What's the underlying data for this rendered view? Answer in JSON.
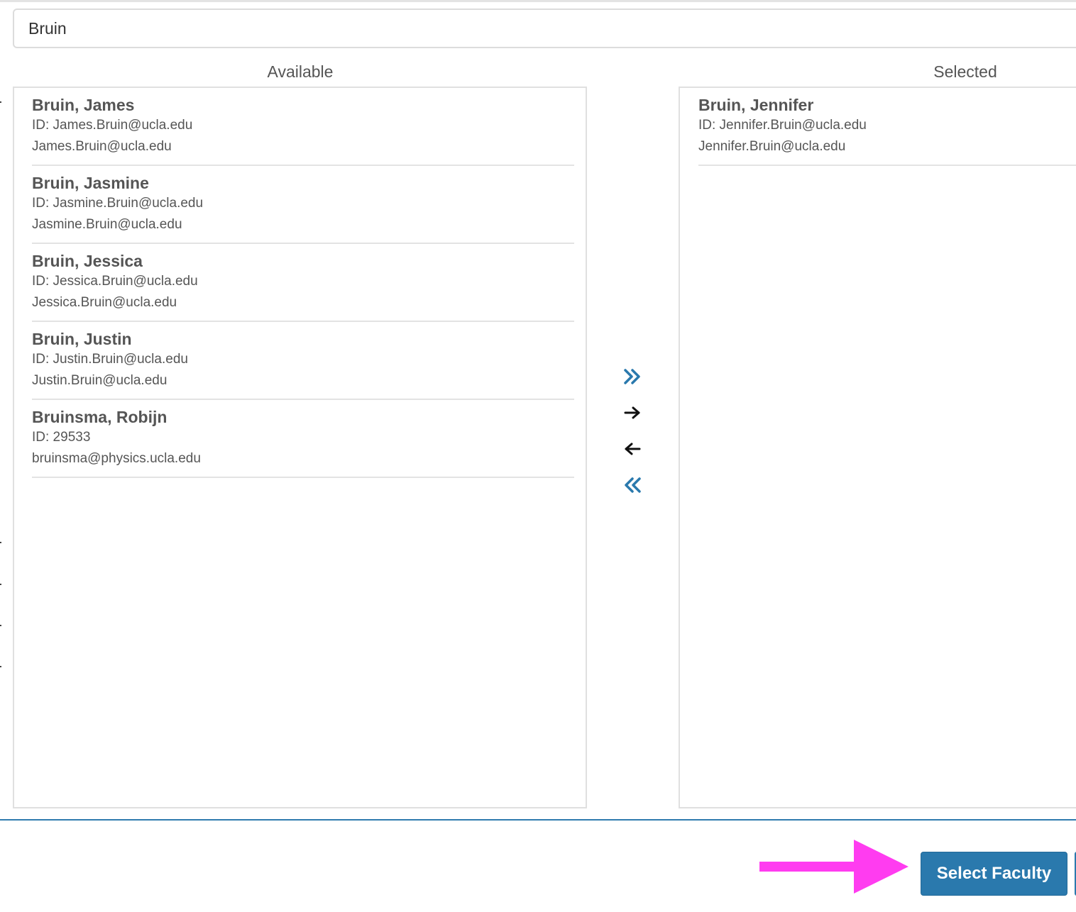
{
  "search": {
    "value": "Bruin"
  },
  "available": {
    "title": "Available",
    "items": [
      {
        "name": "Bruin, James",
        "id": "ID: James.Bruin@ucla.edu",
        "email": "James.Bruin@ucla.edu"
      },
      {
        "name": "Bruin, Jasmine",
        "id": "ID: Jasmine.Bruin@ucla.edu",
        "email": "Jasmine.Bruin@ucla.edu"
      },
      {
        "name": "Bruin, Jessica",
        "id": "ID: Jessica.Bruin@ucla.edu",
        "email": "Jessica.Bruin@ucla.edu"
      },
      {
        "name": "Bruin, Justin",
        "id": "ID: Justin.Bruin@ucla.edu",
        "email": "Justin.Bruin@ucla.edu"
      },
      {
        "name": "Bruinsma, Robijn",
        "id": "ID: 29533",
        "email": "bruinsma@physics.ucla.edu"
      }
    ]
  },
  "selected": {
    "title": "Selected",
    "items": [
      {
        "name": "Bruin, Jennifer",
        "id": "ID: Jennifer.Bruin@ucla.edu",
        "email": "Jennifer.Bruin@ucla.edu"
      }
    ]
  },
  "controls": {
    "icons": [
      "double-chevron-right-icon",
      "arrow-right-icon",
      "arrow-left-icon",
      "double-chevron-left-icon"
    ]
  },
  "footer": {
    "select_label": "Select Faculty"
  },
  "colors": {
    "accent": "#2a79ad",
    "annotation_arrow": "#ff3cf0",
    "text": "#555555",
    "border": "#e0e0e0"
  }
}
